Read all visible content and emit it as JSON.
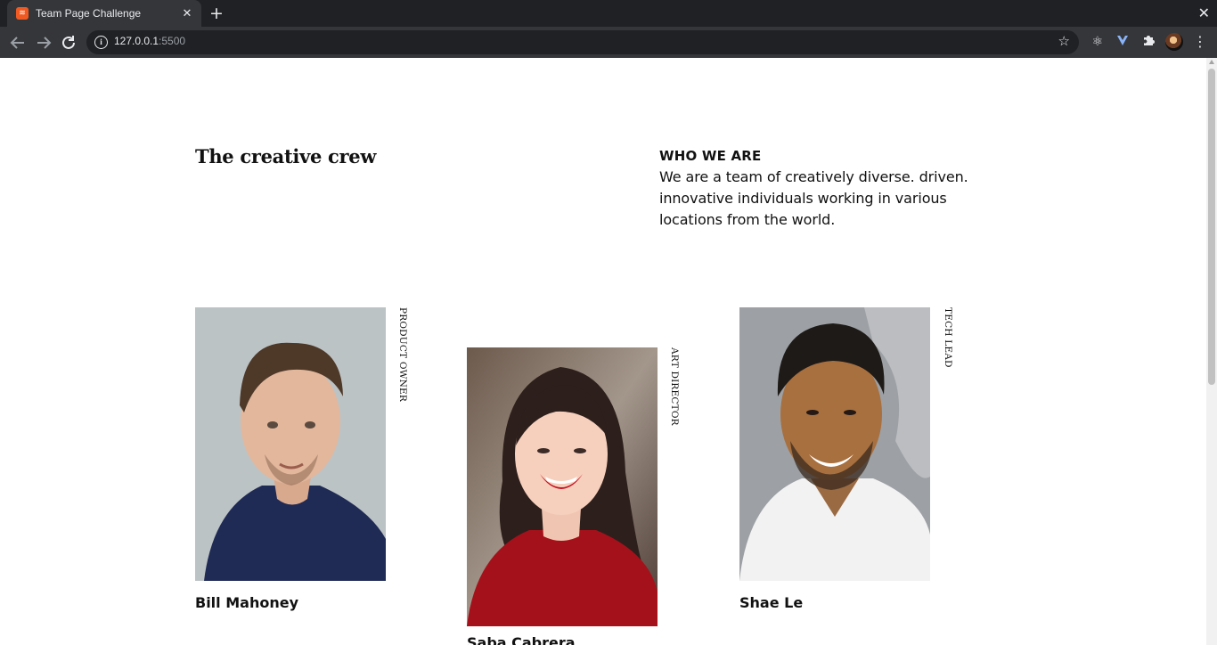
{
  "browser": {
    "tab_title": "Team Page Challenge",
    "favicon_text": "≋",
    "close_tab": "✕",
    "new_tab": "+",
    "window_close": "✕",
    "url_host": "127.0.0.1",
    "url_port": ":5500",
    "icons": {
      "back": "arrow-left-icon",
      "forward": "arrow-right-icon",
      "reload": "reload-icon",
      "bookmark": "star-icon",
      "extensions": [
        "react-devtools-icon",
        "vue-devtools-icon",
        "puzzle-icon"
      ],
      "menu": "kebab-menu-icon"
    }
  },
  "page": {
    "title": "The creative crew",
    "who": {
      "heading": "WHO WE ARE",
      "text": "We are a team of creatively diverse. driven. innovative individuals working in various locations from the world."
    },
    "team": [
      {
        "name": "Bill Mahoney",
        "role": "PRODUCT OWNER"
      },
      {
        "name": "Saba Cabrera",
        "role": "ART DIRECTOR"
      },
      {
        "name": "Shae Le",
        "role": "TECH LEAD"
      }
    ]
  },
  "colors": {
    "chrome_dark": "#202124",
    "chrome_toolbar": "#35363a",
    "text": "#111111",
    "favicon": "#f05a22"
  }
}
